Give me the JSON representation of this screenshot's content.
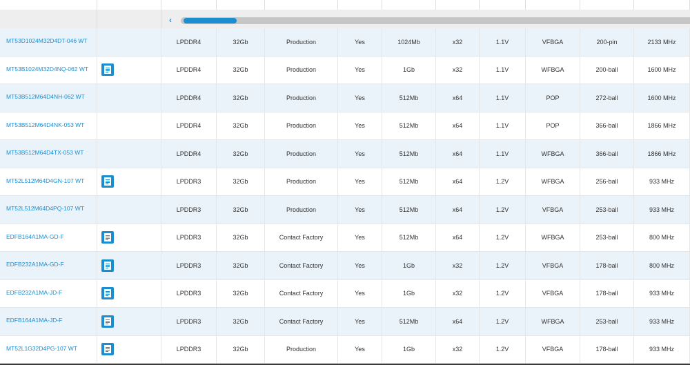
{
  "colors": {
    "accent": "#1a8ed1",
    "row_alt": "#eaf3fa",
    "scroll_track": "#c6c6c6"
  },
  "scrollbar": {
    "left_arrow_icon": "chevron-left-icon",
    "left_arrow_glyph": "‹"
  },
  "table": {
    "rows": [
      {
        "part": "MT53D1024M32D4DT-046 WT",
        "doc": false,
        "type": "LPDDR4",
        "density": "32Gb",
        "status": "Production",
        "rohs": "Yes",
        "depth": "1024Mb",
        "width": "x32",
        "voltage": "1.1V",
        "package": "VFBGA",
        "pins": "200-pin",
        "speed": "2133 MHz"
      },
      {
        "part": "MT53B1024M32D4NQ-062 WT",
        "doc": true,
        "type": "LPDDR4",
        "density": "32Gb",
        "status": "Production",
        "rohs": "Yes",
        "depth": "1Gb",
        "width": "x32",
        "voltage": "1.1V",
        "package": "WFBGA",
        "pins": "200-ball",
        "speed": "1600 MHz"
      },
      {
        "part": "MT53B512M64D4NH-062 WT",
        "doc": false,
        "type": "LPDDR4",
        "density": "32Gb",
        "status": "Production",
        "rohs": "Yes",
        "depth": "512Mb",
        "width": "x64",
        "voltage": "1.1V",
        "package": "POP",
        "pins": "272-ball",
        "speed": "1600 MHz"
      },
      {
        "part": "MT53B512M64D4NK-053 WT",
        "doc": false,
        "type": "LPDDR4",
        "density": "32Gb",
        "status": "Production",
        "rohs": "Yes",
        "depth": "512Mb",
        "width": "x64",
        "voltage": "1.1V",
        "package": "POP",
        "pins": "366-ball",
        "speed": "1866 MHz"
      },
      {
        "part": "MT53B512M64D4TX-053 WT",
        "doc": false,
        "type": "LPDDR4",
        "density": "32Gb",
        "status": "Production",
        "rohs": "Yes",
        "depth": "512Mb",
        "width": "x64",
        "voltage": "1.1V",
        "package": "WFBGA",
        "pins": "366-ball",
        "speed": "1866 MHz"
      },
      {
        "part": "MT52L512M64D4GN-107 WT",
        "doc": true,
        "type": "LPDDR3",
        "density": "32Gb",
        "status": "Production",
        "rohs": "Yes",
        "depth": "512Mb",
        "width": "x64",
        "voltage": "1.2V",
        "package": "WFBGA",
        "pins": "256-ball",
        "speed": "933 MHz"
      },
      {
        "part": "MT52L512M64D4PQ-107 WT",
        "doc": false,
        "type": "LPDDR3",
        "density": "32Gb",
        "status": "Production",
        "rohs": "Yes",
        "depth": "512Mb",
        "width": "x64",
        "voltage": "1.2V",
        "package": "VFBGA",
        "pins": "253-ball",
        "speed": "933 MHz"
      },
      {
        "part": "EDFB164A1MA-GD-F",
        "doc": true,
        "type": "LPDDR3",
        "density": "32Gb",
        "status": "Contact Factory",
        "rohs": "Yes",
        "depth": "512Mb",
        "width": "x64",
        "voltage": "1.2V",
        "package": "WFBGA",
        "pins": "253-ball",
        "speed": "800 MHz"
      },
      {
        "part": "EDFB232A1MA-GD-F",
        "doc": true,
        "type": "LPDDR3",
        "density": "32Gb",
        "status": "Contact Factory",
        "rohs": "Yes",
        "depth": "1Gb",
        "width": "x32",
        "voltage": "1.2V",
        "package": "VFBGA",
        "pins": "178-ball",
        "speed": "800 MHz"
      },
      {
        "part": "EDFB232A1MA-JD-F",
        "doc": true,
        "type": "LPDDR3",
        "density": "32Gb",
        "status": "Contact Factory",
        "rohs": "Yes",
        "depth": "1Gb",
        "width": "x32",
        "voltage": "1.2V",
        "package": "VFBGA",
        "pins": "178-ball",
        "speed": "933 MHz"
      },
      {
        "part": "EDFB164A1MA-JD-F",
        "doc": true,
        "type": "LPDDR3",
        "density": "32Gb",
        "status": "Contact Factory",
        "rohs": "Yes",
        "depth": "512Mb",
        "width": "x64",
        "voltage": "1.2V",
        "package": "WFBGA",
        "pins": "253-ball",
        "speed": "933 MHz"
      },
      {
        "part": "MT52L1G32D4PG-107 WT",
        "doc": true,
        "type": "LPDDR3",
        "density": "32Gb",
        "status": "Production",
        "rohs": "Yes",
        "depth": "1Gb",
        "width": "x32",
        "voltage": "1.2V",
        "package": "VFBGA",
        "pins": "178-ball",
        "speed": "933 MHz"
      }
    ]
  }
}
